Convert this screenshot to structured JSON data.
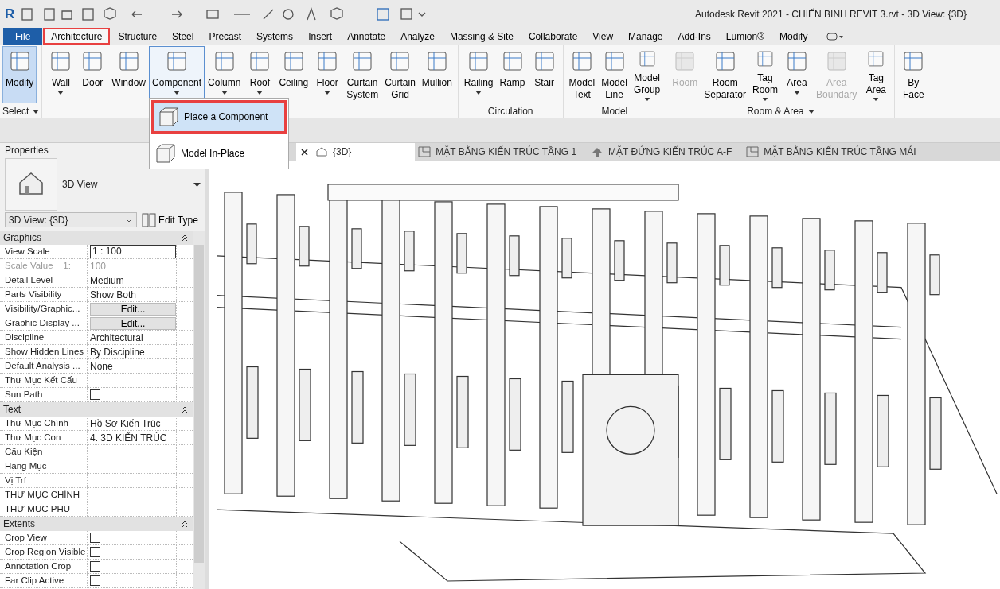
{
  "title_bar": {
    "app_logo": "R",
    "title": "Autodesk Revit 2021 - CHIẾN BINH REVIT 3.rvt - 3D View: {3D}"
  },
  "ribbon_tabs": [
    {
      "label": "File",
      "kind": "file",
      "selected": false,
      "annotated": false
    },
    {
      "label": "Architecture",
      "kind": "tab",
      "selected": true,
      "annotated": true
    },
    {
      "label": "Structure",
      "kind": "tab",
      "selected": false,
      "annotated": false
    },
    {
      "label": "Steel",
      "kind": "tab",
      "selected": false,
      "annotated": false
    },
    {
      "label": "Precast",
      "kind": "tab",
      "selected": false,
      "annotated": false
    },
    {
      "label": "Systems",
      "kind": "tab",
      "selected": false,
      "annotated": false
    },
    {
      "label": "Insert",
      "kind": "tab",
      "selected": false,
      "annotated": false
    },
    {
      "label": "Annotate",
      "kind": "tab",
      "selected": false,
      "annotated": false
    },
    {
      "label": "Analyze",
      "kind": "tab",
      "selected": false,
      "annotated": false
    },
    {
      "label": "Massing & Site",
      "kind": "tab",
      "selected": false,
      "annotated": false
    },
    {
      "label": "Collaborate",
      "kind": "tab",
      "selected": false,
      "annotated": false
    },
    {
      "label": "View",
      "kind": "tab",
      "selected": false,
      "annotated": false
    },
    {
      "label": "Manage",
      "kind": "tab",
      "selected": false,
      "annotated": false
    },
    {
      "label": "Add-Ins",
      "kind": "tab",
      "selected": false,
      "annotated": false
    },
    {
      "label": "Lumion®",
      "kind": "tab",
      "selected": false,
      "annotated": false
    },
    {
      "label": "Modify",
      "kind": "tab",
      "selected": false,
      "annotated": false
    }
  ],
  "ribbon_panels": [
    {
      "label": "Select",
      "has_menu": true,
      "tools": [
        {
          "label": "Modify",
          "selected": true,
          "disabled": false,
          "dropdown": false,
          "expanded": false
        }
      ]
    },
    {
      "tools": [
        {
          "label": "Wall",
          "selected": false,
          "disabled": false,
          "dropdown": true,
          "expanded": false
        },
        {
          "label": "Door",
          "selected": false,
          "disabled": false,
          "dropdown": false,
          "expanded": false
        },
        {
          "label": "Window",
          "selected": false,
          "disabled": false,
          "dropdown": false,
          "expanded": false
        },
        {
          "label": "Component",
          "selected": false,
          "disabled": false,
          "dropdown": true,
          "expanded": true
        },
        {
          "label": "Column",
          "selected": false,
          "disabled": false,
          "dropdown": true,
          "expanded": false
        },
        {
          "label": "Roof",
          "selected": false,
          "disabled": false,
          "dropdown": true,
          "expanded": false
        },
        {
          "label": "Ceiling",
          "selected": false,
          "disabled": false,
          "dropdown": false,
          "expanded": false
        },
        {
          "label": "Floor",
          "selected": false,
          "disabled": false,
          "dropdown": true,
          "expanded": false
        },
        {
          "label": "Curtain System",
          "selected": false,
          "disabled": false,
          "dropdown": false,
          "expanded": false
        },
        {
          "label": "Curtain Grid",
          "selected": false,
          "disabled": false,
          "dropdown": false,
          "expanded": false
        },
        {
          "label": "Mullion",
          "selected": false,
          "disabled": false,
          "dropdown": false,
          "expanded": false
        }
      ]
    },
    {
      "label": "Circulation",
      "has_menu": false,
      "tools": [
        {
          "label": "Railing",
          "selected": false,
          "disabled": false,
          "dropdown": true,
          "expanded": false
        },
        {
          "label": "Ramp",
          "selected": false,
          "disabled": false,
          "dropdown": false,
          "expanded": false
        },
        {
          "label": "Stair",
          "selected": false,
          "disabled": false,
          "dropdown": false,
          "expanded": false
        }
      ]
    },
    {
      "label": "Model",
      "has_menu": false,
      "tools": [
        {
          "label": "Model Text",
          "selected": false,
          "disabled": false,
          "dropdown": false,
          "expanded": false
        },
        {
          "label": "Model Line",
          "selected": false,
          "disabled": false,
          "dropdown": false,
          "expanded": false
        },
        {
          "label": "Model Group",
          "selected": false,
          "disabled": false,
          "dropdown": true,
          "expanded": false
        }
      ]
    },
    {
      "label": "Room & Area",
      "has_menu": true,
      "tools": [
        {
          "label": "Room",
          "selected": false,
          "disabled": true,
          "dropdown": false,
          "expanded": false
        },
        {
          "label": "Room Separator",
          "selected": false,
          "disabled": false,
          "dropdown": false,
          "expanded": false
        },
        {
          "label": "Tag Room",
          "selected": false,
          "disabled": false,
          "dropdown": true,
          "expanded": false
        },
        {
          "label": "Area",
          "selected": false,
          "disabled": false,
          "dropdown": true,
          "expanded": false
        },
        {
          "label": "Area Boundary",
          "selected": false,
          "disabled": true,
          "dropdown": false,
          "expanded": false
        },
        {
          "label": "Tag Area",
          "selected": false,
          "disabled": false,
          "dropdown": true,
          "expanded": false
        }
      ]
    },
    {
      "tools": [
        {
          "label": "By Face",
          "selected": false,
          "disabled": false,
          "dropdown": false,
          "expanded": false
        }
      ]
    }
  ],
  "component_menu": [
    {
      "label": "Place a Component",
      "selected": true,
      "annotated": true
    },
    {
      "label": "Model In-Place",
      "selected": false,
      "annotated": false
    }
  ],
  "properties": {
    "title": "Properties",
    "type_name": "3D View",
    "instance": "3D View: {3D}",
    "edit_type": "Edit Type",
    "sections": [
      {
        "label": "Graphics",
        "rows": [
          {
            "label": "View Scale",
            "kind": "input",
            "value": "1 : 100",
            "disabled": false
          },
          {
            "label": "Scale Value    1:",
            "kind": "text",
            "value": "100",
            "disabled": true
          },
          {
            "label": "Detail Level",
            "kind": "text",
            "value": "Medium",
            "disabled": false
          },
          {
            "label": "Parts Visibility",
            "kind": "text",
            "value": "Show Both",
            "disabled": false
          },
          {
            "label": "Visibility/Graphic...",
            "kind": "button",
            "value": "Edit...",
            "disabled": false
          },
          {
            "label": "Graphic Display ...",
            "kind": "button",
            "value": "Edit...",
            "disabled": false
          },
          {
            "label": "Discipline",
            "kind": "text",
            "value": "Architectural",
            "disabled": false
          },
          {
            "label": "Show Hidden Lines",
            "kind": "text",
            "value": "By Discipline",
            "disabled": false
          },
          {
            "label": "Default Analysis ...",
            "kind": "text",
            "value": "None",
            "disabled": false
          },
          {
            "label": "Thư Mục Kết Cấu",
            "kind": "text",
            "disabled": false
          },
          {
            "label": "Sun Path",
            "kind": "checkbox",
            "checked": false,
            "disabled": false
          }
        ]
      },
      {
        "label": "Text",
        "rows": [
          {
            "label": "Thư Mục Chính",
            "kind": "text",
            "value": "Hồ Sơ Kiến Trúc",
            "disabled": false
          },
          {
            "label": "Thư Mục Con",
            "kind": "text",
            "value": "4. 3D KIẾN TRÚC",
            "disabled": false
          },
          {
            "label": "Cấu Kiện",
            "kind": "text",
            "disabled": false
          },
          {
            "label": "Hạng Mục",
            "kind": "text",
            "disabled": false
          },
          {
            "label": "Vị Trí",
            "kind": "text",
            "disabled": false
          },
          {
            "label": "THƯ MỤC CHÍNH",
            "kind": "text",
            "disabled": false
          },
          {
            "label": "THƯ MỤC PHỤ",
            "kind": "text",
            "disabled": false
          }
        ]
      },
      {
        "label": "Extents",
        "rows": [
          {
            "label": "Crop View",
            "kind": "checkbox",
            "checked": false,
            "disabled": false
          },
          {
            "label": "Crop Region Visible",
            "kind": "checkbox",
            "checked": false,
            "disabled": false
          },
          {
            "label": "Annotation Crop",
            "kind": "checkbox",
            "checked": false,
            "disabled": false
          },
          {
            "label": "Far Clip Active",
            "kind": "checkbox",
            "checked": false,
            "disabled": false
          }
        ]
      }
    ]
  },
  "view_tabs": [
    {
      "label": "{3D}",
      "selected": true,
      "kind": "model"
    },
    {
      "label": "MẶT BẰNG KIẾN TRÚC TẦNG 1",
      "selected": false,
      "kind": "plan"
    },
    {
      "label": "MẶT ĐỨNG KIẾN TRÚC A-F",
      "selected": false,
      "kind": "elevation"
    },
    {
      "label": "MẶT BẰNG KIẾN TRÚC TẦNG MÁI",
      "selected": false,
      "kind": "plan"
    }
  ]
}
